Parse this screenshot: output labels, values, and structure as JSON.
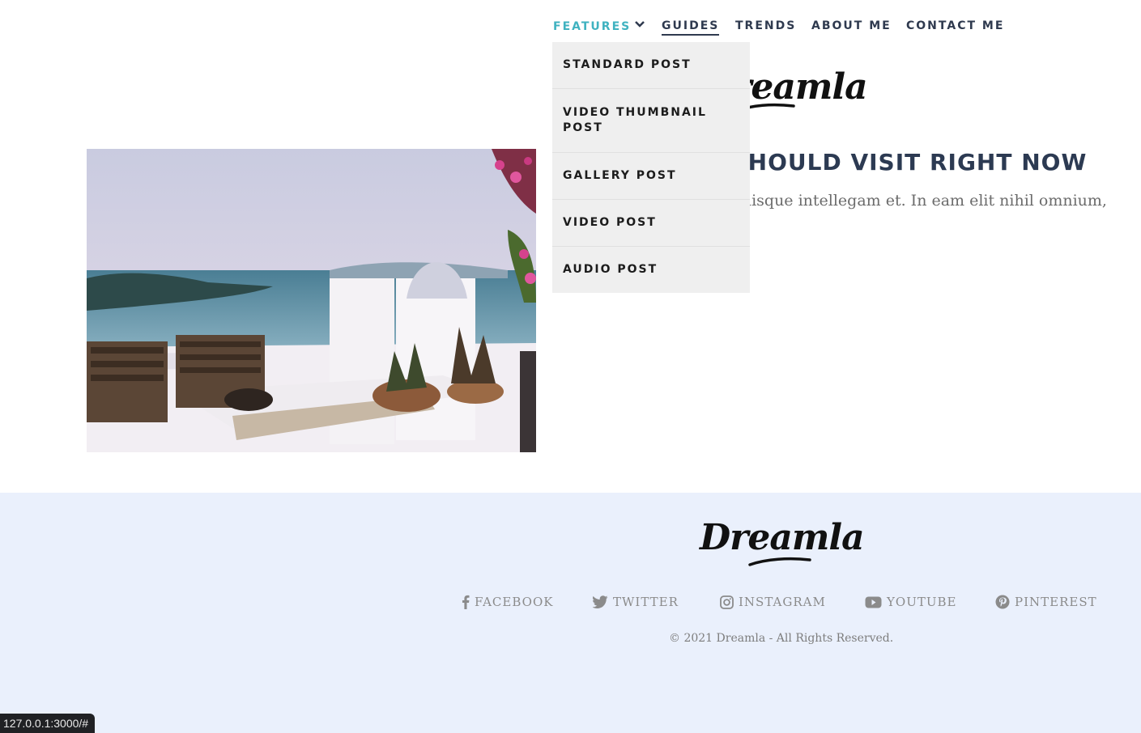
{
  "nav": {
    "features": "FEATURES",
    "guides": "GUIDES",
    "trends": "TRENDS",
    "about": "ABOUT ME",
    "contact": "CONTACT ME"
  },
  "dropdown": {
    "items": [
      "STANDARD POST",
      "VIDEO THUMBNAIL POST",
      "GALLERY POST",
      "VIDEO POST",
      "AUDIO POST"
    ]
  },
  "header": {
    "logo": "Dreamla"
  },
  "post": {
    "title": "U SHOULD VISIT RIGHT NOW",
    "excerpt": "n qualisque intellegam et. In eam elit nihil omnium,"
  },
  "footer": {
    "logo": "Dreamla",
    "social": {
      "facebook": "FACEBOOK",
      "twitter": "TWITTER",
      "instagram": "INSTAGRAM",
      "youtube": "YOUTUBE",
      "pinterest": "PINTEREST"
    },
    "copyright": "© 2021 Dreamla - All Rights Reserved."
  },
  "status_bar": {
    "url": "127.0.0.1:3000/#"
  },
  "colors": {
    "accent": "#3fb2c0",
    "nav_text": "#2f3a4f",
    "footer_bg": "#eaf0fc",
    "dropdown_bg": "#efefef"
  },
  "icons": {
    "features_chevron": "chevron-down-icon",
    "facebook": "facebook-icon",
    "twitter": "twitter-icon",
    "instagram": "instagram-icon",
    "youtube": "youtube-icon",
    "pinterest": "pinterest-icon"
  }
}
